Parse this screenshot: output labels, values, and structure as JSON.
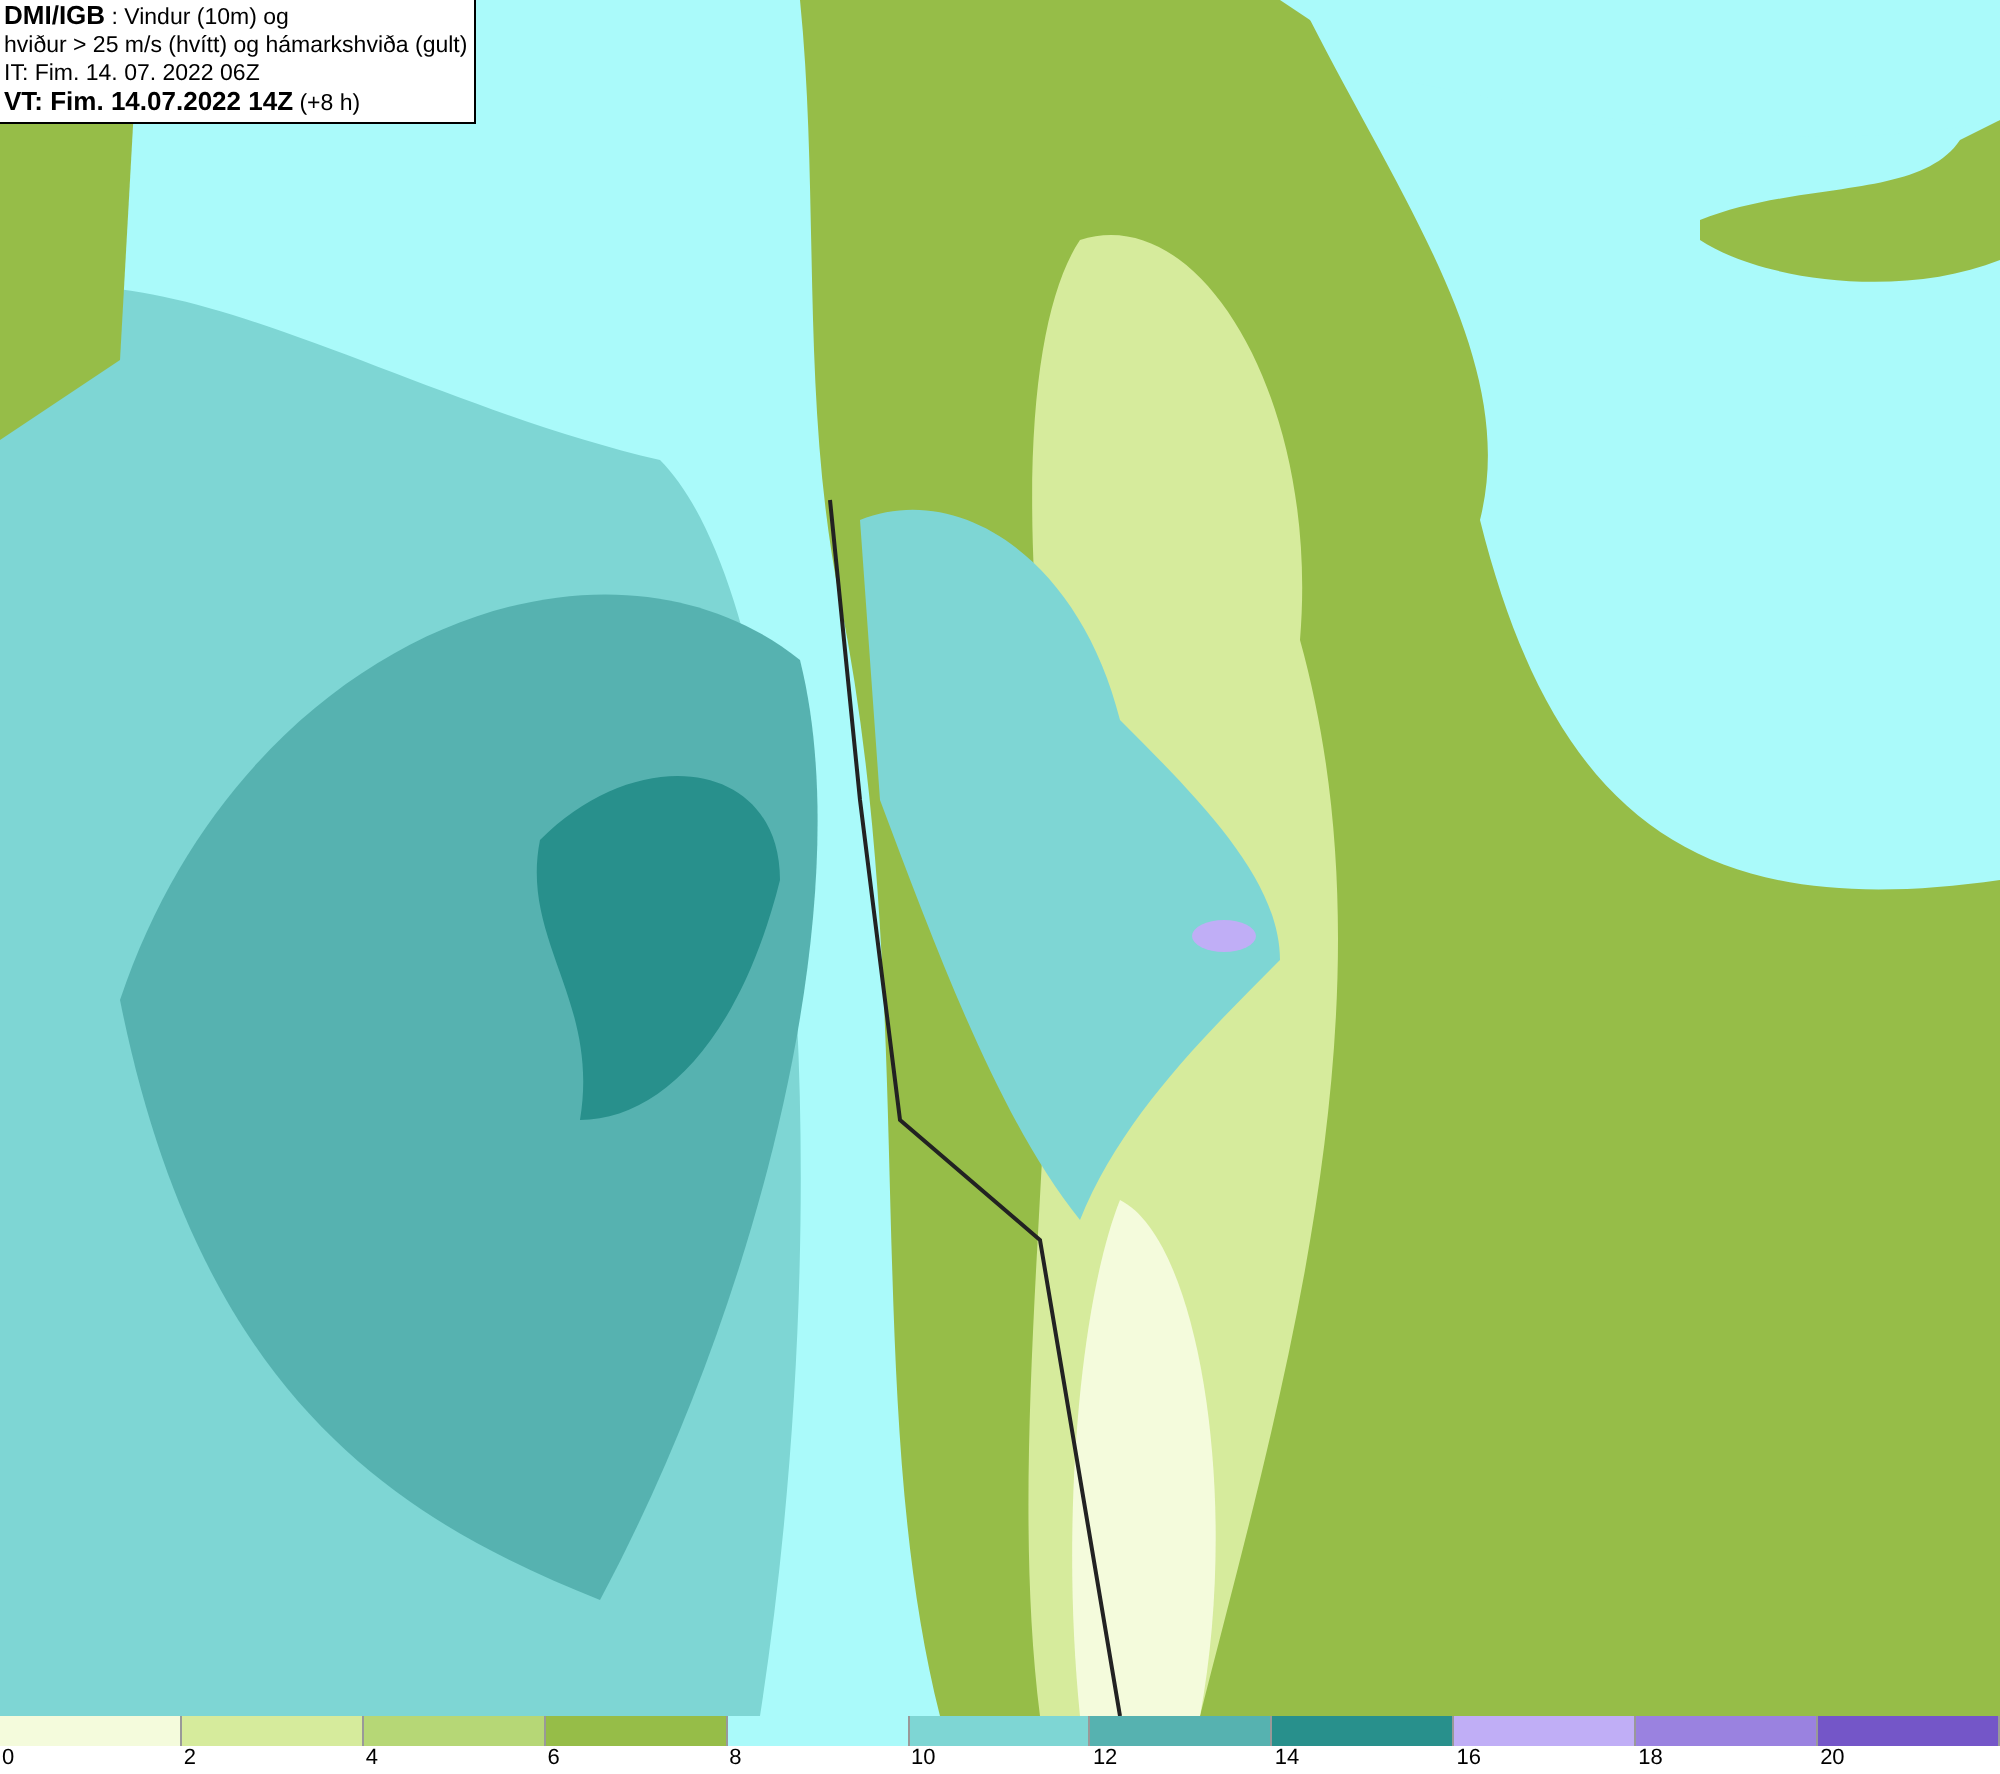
{
  "header": {
    "lines": [
      "**DMI/IGB** : Vindur (10m) og",
      "hviður > 25 m/s (hvítt) og hámarkshviða (gult)",
      "IT: Fim. 14. 07. 2022 06Z",
      "**VT: Fim. 14.07.2022 14Z** (+8 h)"
    ]
  },
  "legend": [
    {
      "label": "0",
      "color": "#f4fbdc"
    },
    {
      "label": "2",
      "color": "#d6eb9c"
    },
    {
      "label": "4",
      "color": "#b6d776"
    },
    {
      "label": "6",
      "color": "#96bd48"
    },
    {
      "label": "8",
      "color": "#aafafa"
    },
    {
      "label": "10",
      "color": "#7ed6d4"
    },
    {
      "label": "12",
      "color": "#56b2b0"
    },
    {
      "label": "14",
      "color": "#28908c"
    },
    {
      "label": "16",
      "color": "#c0aef6"
    },
    {
      "label": "18",
      "color": "#9a82e0"
    },
    {
      "label": "20",
      "color": "#7456c8"
    }
  ]
}
